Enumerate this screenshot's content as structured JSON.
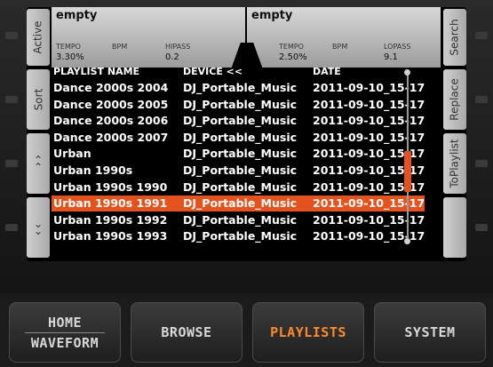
{
  "deck_left": {
    "title": "empty",
    "tempo_label": "TEMPO",
    "bpm_label": "BPM",
    "filter_label": "HIPASS",
    "tempo_value": "3.30%",
    "filter_value": "0.2"
  },
  "deck_right": {
    "title": "empty",
    "tempo_label": "TEMPO",
    "bpm_label": "BPM",
    "filter_label": "LOPASS",
    "tempo_value": "2.50%",
    "filter_value": "9.1"
  },
  "left_buttons": {
    "active": "Active",
    "sort": "Sort",
    "up": "^",
    "down": "v"
  },
  "right_buttons": {
    "search": "Search",
    "replace": "Replace",
    "to_playlist": "ToPlaylist"
  },
  "columns": {
    "name": "PLAYLIST NAME",
    "device": "DEVICE <<",
    "date": "DATE"
  },
  "rows": [
    {
      "name": "Dance 2000s 2004",
      "device": "DJ_Portable_Music",
      "date": "2011-09-10_15-17"
    },
    {
      "name": "Dance 2000s 2005",
      "device": "DJ_Portable_Music",
      "date": "2011-09-10_15-17"
    },
    {
      "name": "Dance 2000s 2006",
      "device": "DJ_Portable_Music",
      "date": "2011-09-10_15-17"
    },
    {
      "name": "Dance 2000s 2007",
      "device": "DJ_Portable_Music",
      "date": "2011-09-10_15-17"
    },
    {
      "name": "Urban",
      "device": "DJ_Portable_Music",
      "date": "2011-09-10_15-17"
    },
    {
      "name": "Urban 1990s",
      "device": "DJ_Portable_Music",
      "date": "2011-09-10_15-17"
    },
    {
      "name": "Urban 1990s 1990",
      "device": "DJ_Portable_Music",
      "date": "2011-09-10_15-17"
    },
    {
      "name": "Urban 1990s 1991",
      "device": "DJ_Portable_Music",
      "date": "2011-09-10_15-17"
    },
    {
      "name": "Urban 1990s 1992",
      "device": "DJ_Portable_Music",
      "date": "2011-09-10_15-17"
    },
    {
      "name": "Urban 1990s 1993",
      "device": "DJ_Portable_Music",
      "date": "2011-09-10_15-17"
    }
  ],
  "selected_row": 7,
  "hardware_buttons": {
    "home_line1": "HOME",
    "home_line2": "WAVEFORM",
    "browse": "BROWSE",
    "playlists": "PLAYLISTS",
    "system": "SYSTEM"
  },
  "colors": {
    "accent": "#e4531d",
    "active_button_text": "#ff8a2a"
  }
}
